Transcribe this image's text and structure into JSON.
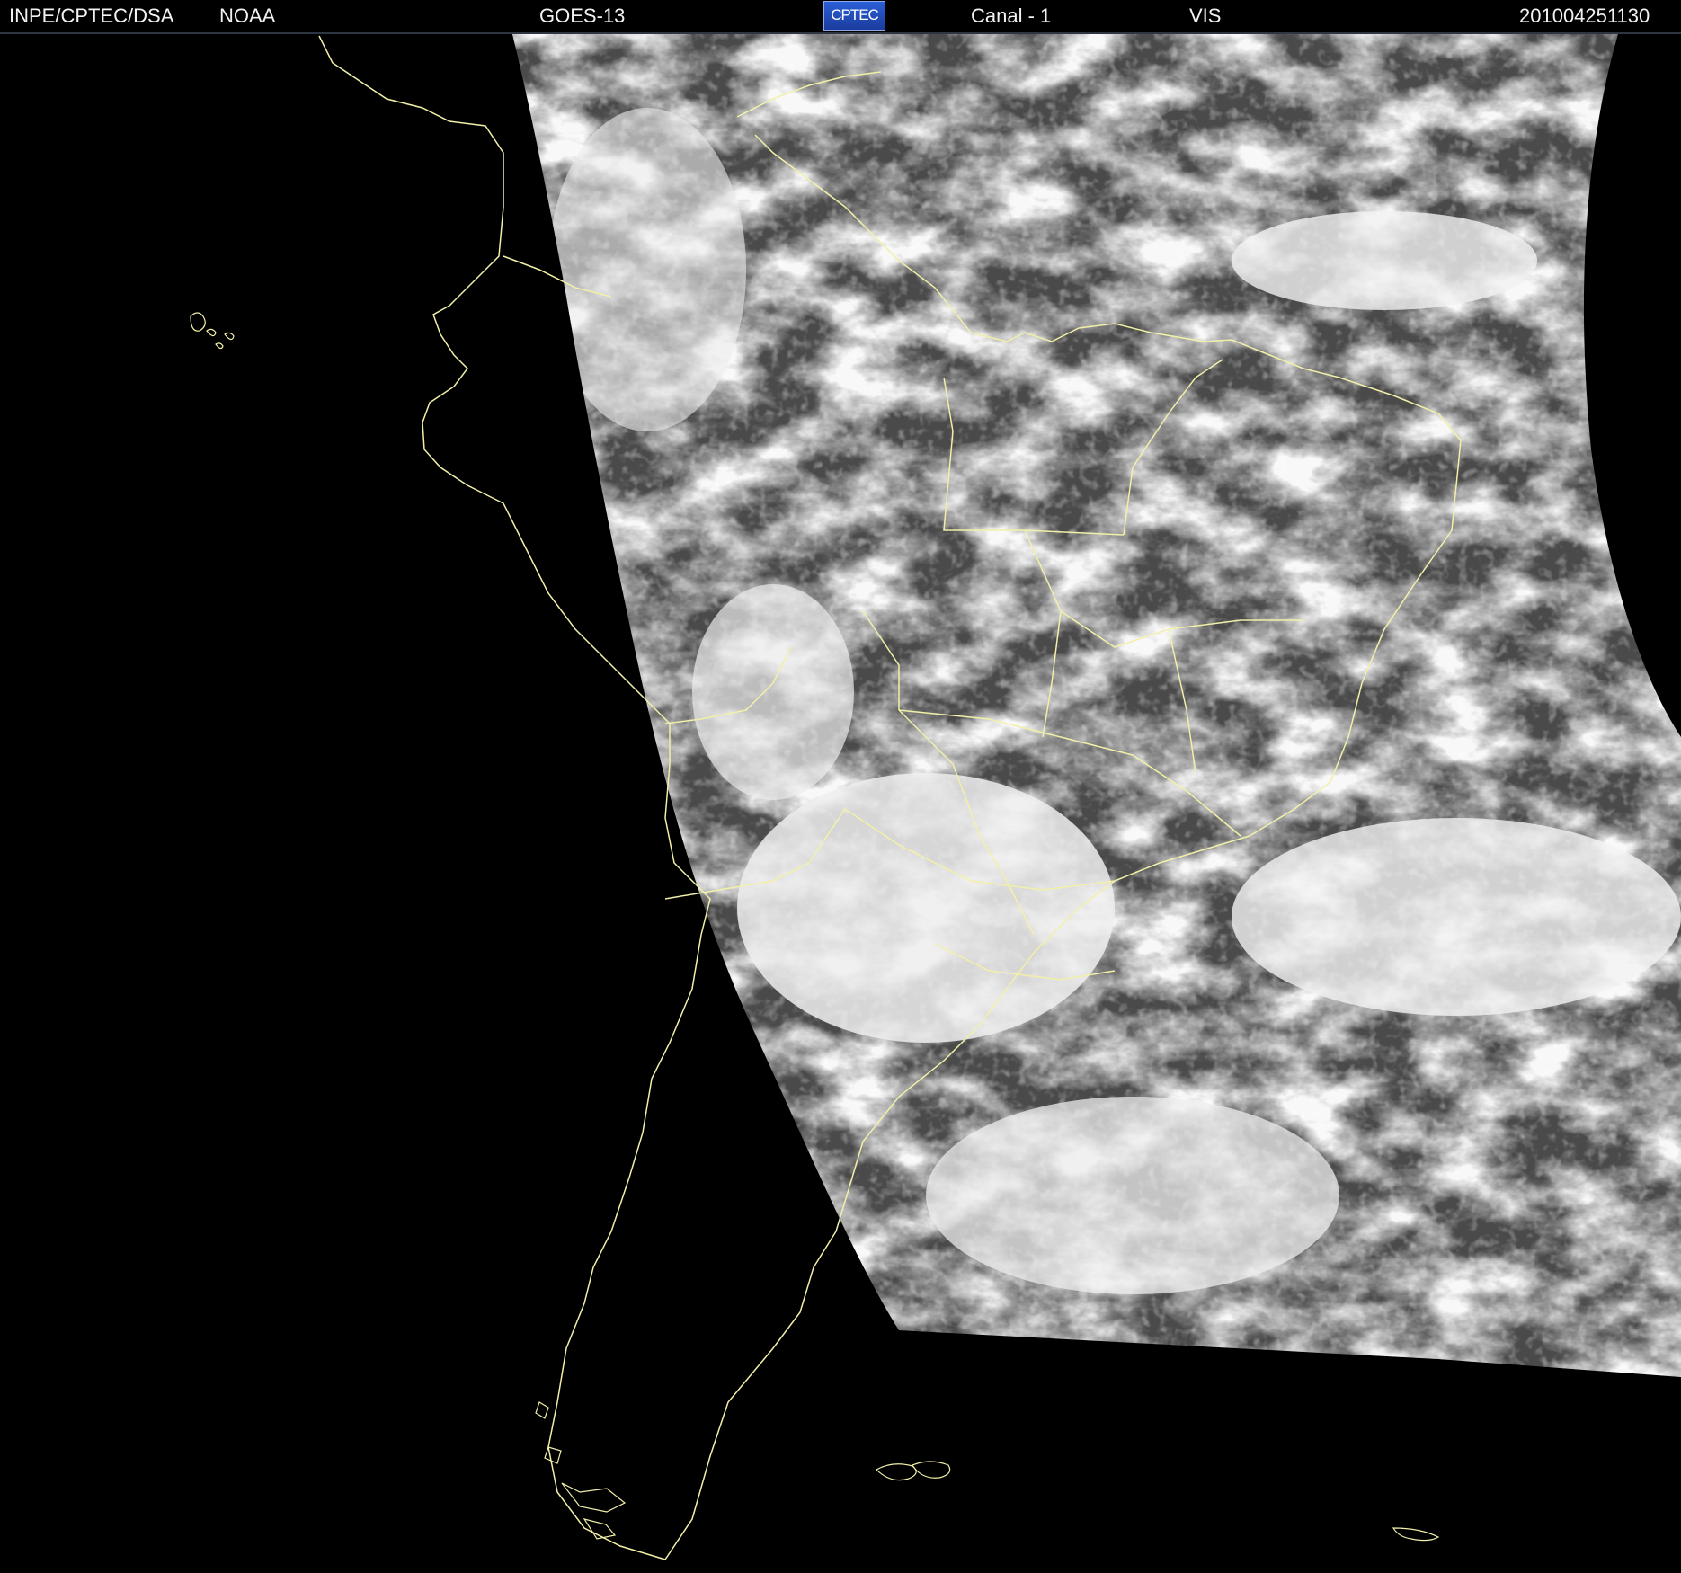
{
  "header": {
    "agency": "INPE/CPTEC/DSA",
    "provider": "NOAA",
    "satellite": "GOES-13",
    "logo_text": "CPTEC",
    "channel": "Canal - 1",
    "band": "VIS",
    "timestamp": "201004251130"
  },
  "colors": {
    "background": "#000000",
    "coastline": "#f2f0a8",
    "cloud": "#f0f0f0",
    "land_ocean": "#4a4a4a",
    "header_text": "#f2f2f2",
    "logo": "#2a5fd6"
  },
  "icons": {
    "logo": "cptec-logo"
  }
}
